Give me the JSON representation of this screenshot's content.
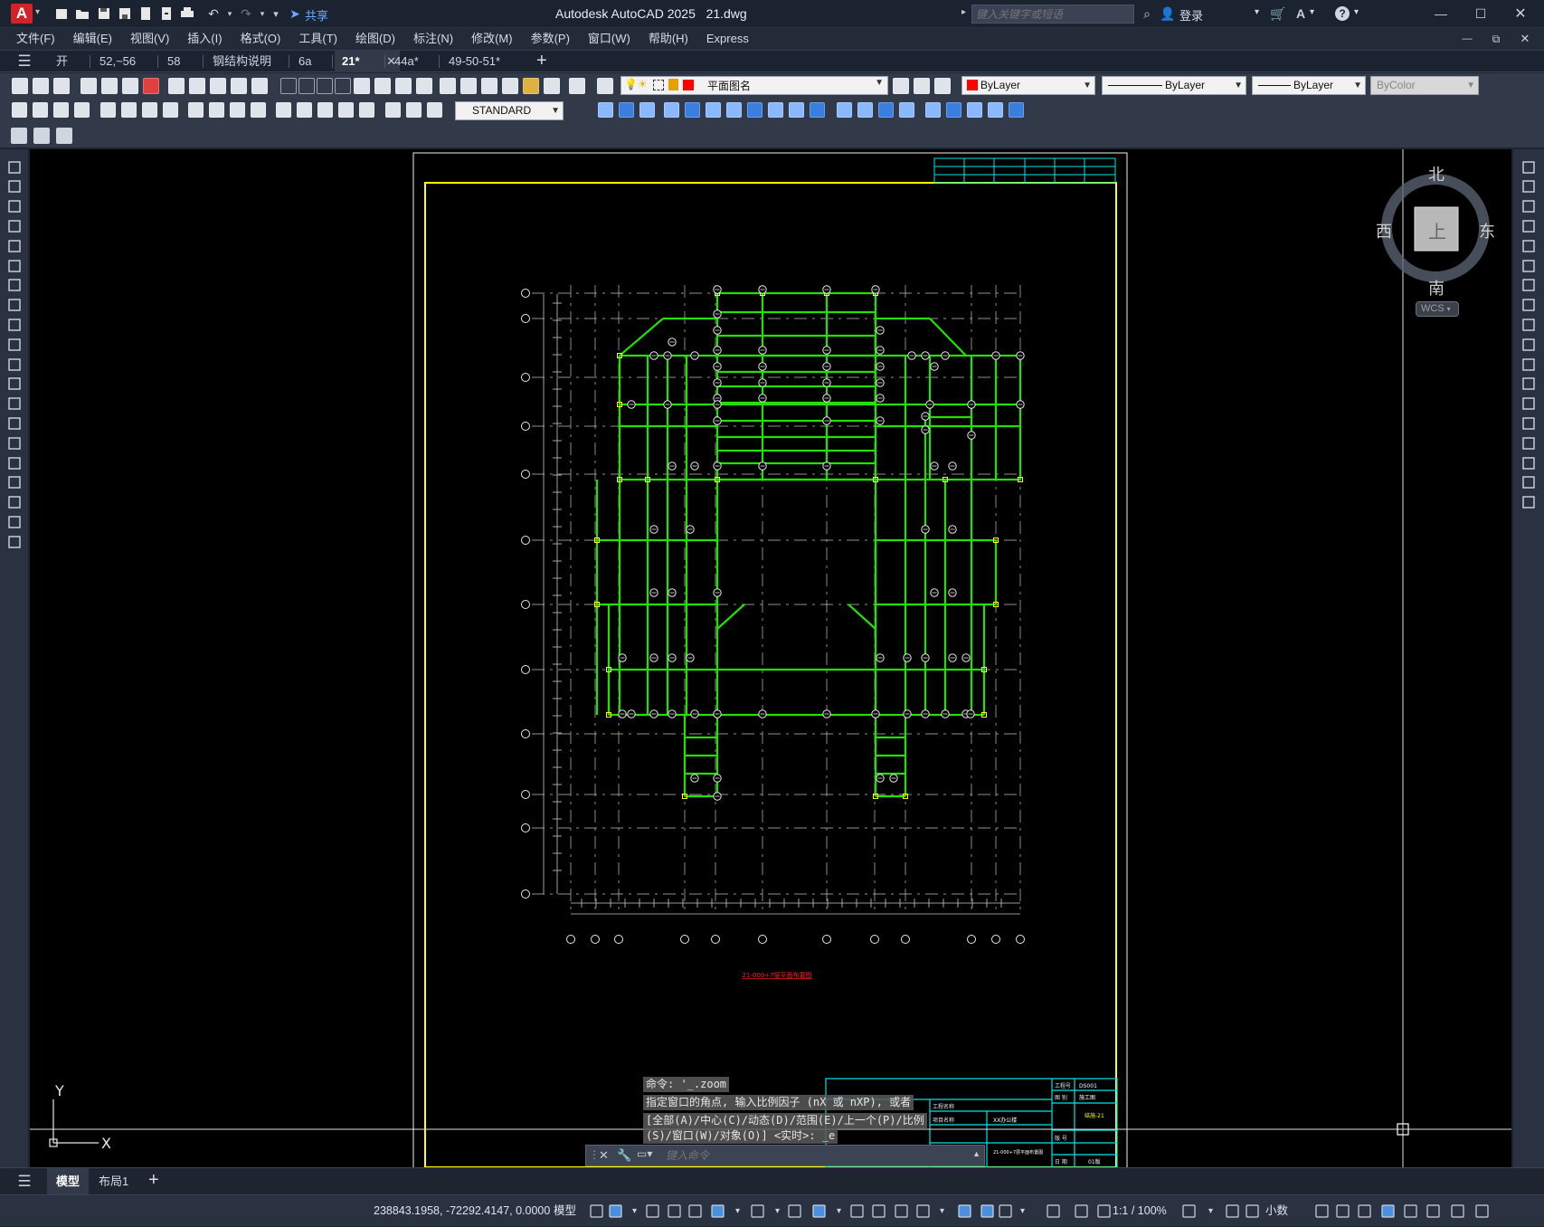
{
  "titlebar": {
    "app_title": "Autodesk AutoCAD 2025",
    "file_name": "21.dwg",
    "search_placeholder": "键入关键字或短语",
    "share_label": "共享",
    "login_label": "登录"
  },
  "menus": [
    "文件(F)",
    "编辑(E)",
    "视图(V)",
    "插入(I)",
    "格式(O)",
    "工具(T)",
    "绘图(D)",
    "标注(N)",
    "修改(M)",
    "参数(P)",
    "窗口(W)",
    "帮助(H)",
    "Express"
  ],
  "tabs": [
    {
      "label": "开始"
    },
    {
      "label": "52,~56"
    },
    {
      "label": "58"
    },
    {
      "label": "钢结构说明"
    },
    {
      "label": "6a"
    },
    {
      "label": "21*",
      "active": true
    },
    {
      "label": "44a*"
    },
    {
      "label": "49-50-51*"
    }
  ],
  "toolbar": {
    "layer_name": "平面图名",
    "color": "ByLayer",
    "linetype": "ByLayer",
    "lineweight": "ByLayer",
    "plotstyle": "ByColor",
    "text_style": "STANDARD"
  },
  "viewcube": {
    "north": "北",
    "south": "南",
    "east": "东",
    "west": "西",
    "top": "上",
    "wcs": "WCS"
  },
  "ucs": {
    "x": "X",
    "y": "Y"
  },
  "drawing": {
    "caption": "21-000+7层平面布置图",
    "titleblock": [
      "工程号",
      "图 别",
      "项目名称",
      "工程名称",
      "图 名",
      "版 号",
      "日 期",
      "DS001",
      "施工图",
      "结施-21",
      "XX办公楼",
      "21-000+7层平面布置图",
      "01版"
    ]
  },
  "command": {
    "history": [
      "命令: '_.zoom",
      "指定窗口的角点, 输入比例因子 (nX 或 nXP), 或者",
      "[全部(A)/中心(C)/动态(D)/范围(E)/上一个(P)/比例",
      "(S)/窗口(W)/对象(O)] <实时>: _e"
    ],
    "placeholder": "键入命令"
  },
  "layout_tabs": [
    "模型",
    "布局1"
  ],
  "status": {
    "coords": "238843.1958, -72292.4147, 0.0000",
    "model": "模型",
    "scale": "1:1 / 100%",
    "units": "小数"
  },
  "colors": {
    "drawing_bg": "#000000",
    "frame_yellow": "#ffff00",
    "steel_green": "#22e000",
    "titleblock_cyan": "#00e5e5",
    "accent_blue": "#4a8fe0",
    "layer_red": "#ff0000"
  }
}
